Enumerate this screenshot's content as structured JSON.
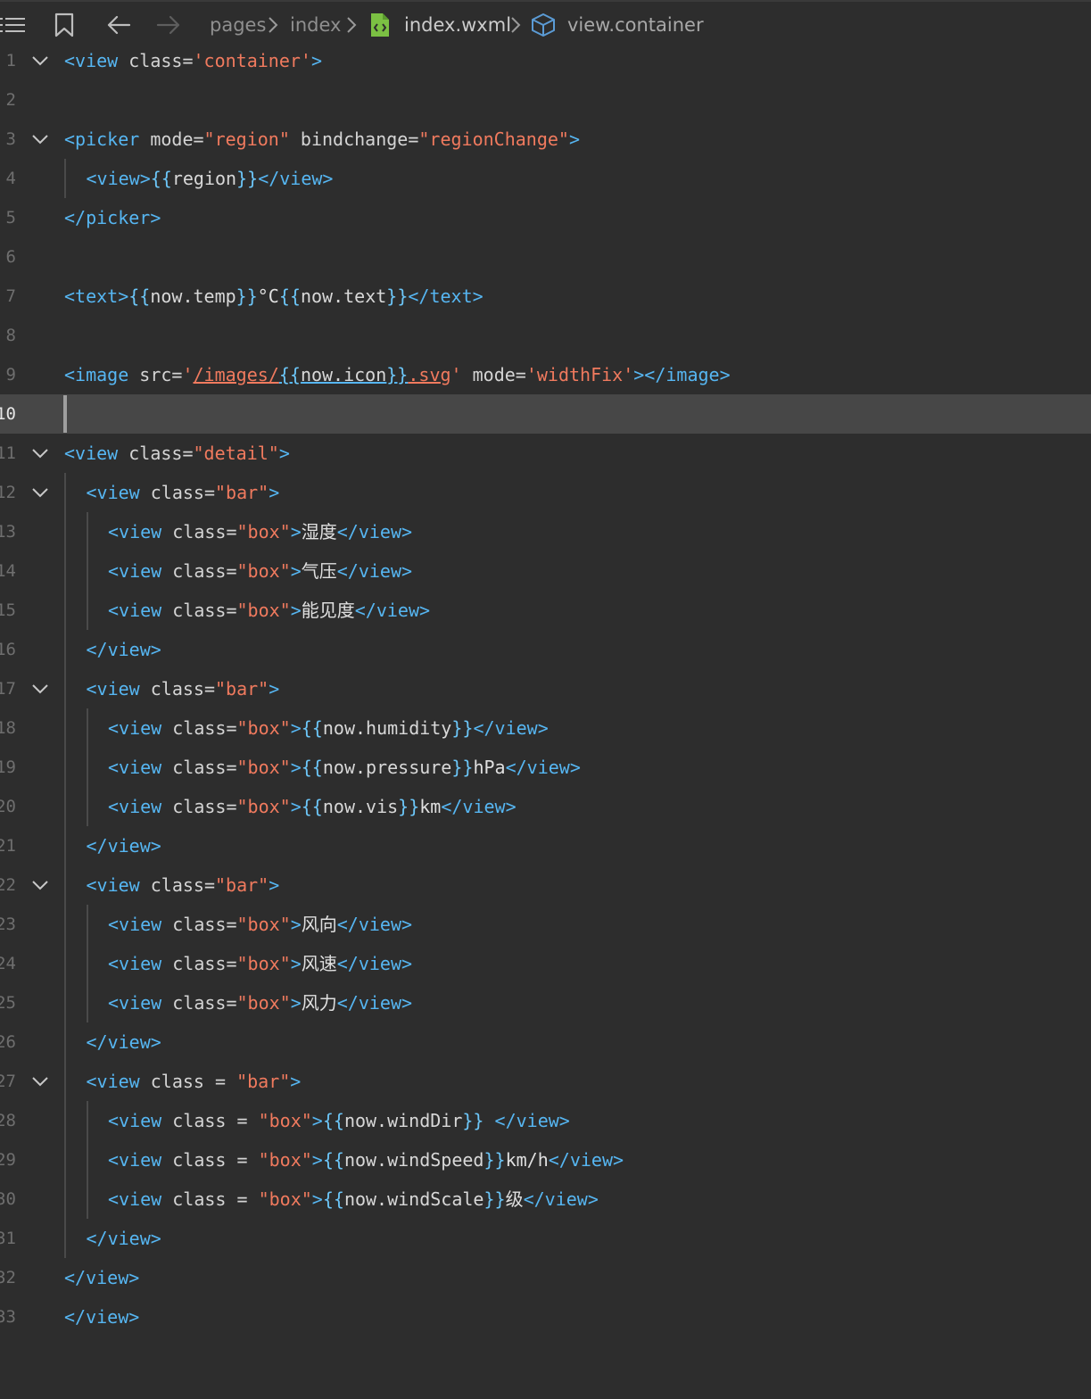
{
  "breadcrumb": {
    "items": [
      "pages",
      "index",
      "index.wxml",
      "view.container"
    ]
  },
  "lines": [
    {
      "n": "1",
      "fold": true,
      "indent": 0,
      "tokens": [
        [
          "tg",
          "<view "
        ],
        [
          "at",
          "class="
        ],
        [
          "st",
          "'container'"
        ],
        [
          "tg",
          ">"
        ]
      ]
    },
    {
      "n": "2",
      "fold": false,
      "indent": 0,
      "tokens": []
    },
    {
      "n": "3",
      "fold": true,
      "indent": 0,
      "tokens": [
        [
          "tg",
          "<picker "
        ],
        [
          "at",
          "mode="
        ],
        [
          "st",
          "\"region\""
        ],
        [
          "at",
          " bindchange="
        ],
        [
          "st",
          "\"regionChange\""
        ],
        [
          "tg",
          ">"
        ]
      ]
    },
    {
      "n": "4",
      "fold": false,
      "indent": 1,
      "tokens": [
        [
          "tg",
          "<view>"
        ],
        [
          "br",
          "{{"
        ],
        [
          "ex",
          "region"
        ],
        [
          "br",
          "}}"
        ],
        [
          "tg",
          "</view>"
        ]
      ]
    },
    {
      "n": "5",
      "fold": false,
      "indent": 0,
      "tokens": [
        [
          "tg",
          "</picker>"
        ]
      ]
    },
    {
      "n": "6",
      "fold": false,
      "indent": 0,
      "tokens": []
    },
    {
      "n": "7",
      "fold": false,
      "indent": 0,
      "tokens": [
        [
          "tg",
          "<text>"
        ],
        [
          "br",
          "{{"
        ],
        [
          "ex",
          "now.temp"
        ],
        [
          "br",
          "}}"
        ],
        [
          "tx",
          "°C"
        ],
        [
          "br",
          "{{"
        ],
        [
          "ex",
          "now.text"
        ],
        [
          "br",
          "}}"
        ],
        [
          "tg",
          "</text>"
        ]
      ]
    },
    {
      "n": "8",
      "fold": false,
      "indent": 0,
      "tokens": []
    },
    {
      "n": "9",
      "fold": false,
      "indent": 0,
      "tokens": [
        [
          "tg",
          "<image "
        ],
        [
          "at",
          "src="
        ],
        [
          "st",
          "'"
        ],
        [
          "stu",
          "/images/"
        ],
        [
          "bru",
          "{{"
        ],
        [
          "exu",
          "now.icon"
        ],
        [
          "bru",
          "}}"
        ],
        [
          "stu",
          ".svg"
        ],
        [
          "st",
          "'"
        ],
        [
          "at",
          " mode="
        ],
        [
          "st",
          "'widthFix'"
        ],
        [
          "tg",
          "></image>"
        ]
      ]
    },
    {
      "n": "10",
      "fold": false,
      "indent": 0,
      "current": true,
      "tokens": []
    },
    {
      "n": "11",
      "fold": true,
      "indent": 0,
      "tokens": [
        [
          "tg",
          "<view "
        ],
        [
          "at",
          "class="
        ],
        [
          "st",
          "\"detail\""
        ],
        [
          "tg",
          ">"
        ]
      ]
    },
    {
      "n": "12",
      "fold": true,
      "indent": 1,
      "tokens": [
        [
          "tg",
          "<view "
        ],
        [
          "at",
          "class="
        ],
        [
          "st",
          "\"bar\""
        ],
        [
          "tg",
          ">"
        ]
      ]
    },
    {
      "n": "13",
      "fold": false,
      "indent": 2,
      "tokens": [
        [
          "tg",
          "<view "
        ],
        [
          "at",
          "class="
        ],
        [
          "st",
          "\"box\""
        ],
        [
          "tg",
          ">"
        ],
        [
          "tx",
          "湿度"
        ],
        [
          "tg",
          "</view>"
        ]
      ]
    },
    {
      "n": "14",
      "fold": false,
      "indent": 2,
      "tokens": [
        [
          "tg",
          "<view "
        ],
        [
          "at",
          "class="
        ],
        [
          "st",
          "\"box\""
        ],
        [
          "tg",
          ">"
        ],
        [
          "tx",
          "气压"
        ],
        [
          "tg",
          "</view>"
        ]
      ]
    },
    {
      "n": "15",
      "fold": false,
      "indent": 2,
      "tokens": [
        [
          "tg",
          "<view "
        ],
        [
          "at",
          "class="
        ],
        [
          "st",
          "\"box\""
        ],
        [
          "tg",
          ">"
        ],
        [
          "tx",
          "能见度"
        ],
        [
          "tg",
          "</view>"
        ]
      ]
    },
    {
      "n": "16",
      "fold": false,
      "indent": 1,
      "tokens": [
        [
          "tg",
          "</view>"
        ]
      ]
    },
    {
      "n": "17",
      "fold": true,
      "indent": 1,
      "tokens": [
        [
          "tg",
          "<view "
        ],
        [
          "at",
          "class="
        ],
        [
          "st",
          "\"bar\""
        ],
        [
          "tg",
          ">"
        ]
      ]
    },
    {
      "n": "18",
      "fold": false,
      "indent": 2,
      "tokens": [
        [
          "tg",
          "<view "
        ],
        [
          "at",
          "class="
        ],
        [
          "st",
          "\"box\""
        ],
        [
          "tg",
          ">"
        ],
        [
          "br",
          "{{"
        ],
        [
          "ex",
          "now.humidity"
        ],
        [
          "br",
          "}}"
        ],
        [
          "tg",
          "</view>"
        ]
      ]
    },
    {
      "n": "19",
      "fold": false,
      "indent": 2,
      "tokens": [
        [
          "tg",
          "<view "
        ],
        [
          "at",
          "class="
        ],
        [
          "st",
          "\"box\""
        ],
        [
          "tg",
          ">"
        ],
        [
          "br",
          "{{"
        ],
        [
          "ex",
          "now.pressure"
        ],
        [
          "br",
          "}}"
        ],
        [
          "tx",
          "hPa"
        ],
        [
          "tg",
          "</view>"
        ]
      ]
    },
    {
      "n": "20",
      "fold": false,
      "indent": 2,
      "tokens": [
        [
          "tg",
          "<view "
        ],
        [
          "at",
          "class="
        ],
        [
          "st",
          "\"box\""
        ],
        [
          "tg",
          ">"
        ],
        [
          "br",
          "{{"
        ],
        [
          "ex",
          "now.vis"
        ],
        [
          "br",
          "}}"
        ],
        [
          "tx",
          "km"
        ],
        [
          "tg",
          "</view>"
        ]
      ]
    },
    {
      "n": "21",
      "fold": false,
      "indent": 1,
      "tokens": [
        [
          "tg",
          "</view>"
        ]
      ]
    },
    {
      "n": "22",
      "fold": true,
      "indent": 1,
      "tokens": [
        [
          "tg",
          "<view "
        ],
        [
          "at",
          "class="
        ],
        [
          "st",
          "\"bar\""
        ],
        [
          "tg",
          ">"
        ]
      ]
    },
    {
      "n": "23",
      "fold": false,
      "indent": 2,
      "tokens": [
        [
          "tg",
          "<view "
        ],
        [
          "at",
          "class="
        ],
        [
          "st",
          "\"box\""
        ],
        [
          "tg",
          ">"
        ],
        [
          "tx",
          "风向"
        ],
        [
          "tg",
          "</view>"
        ]
      ]
    },
    {
      "n": "24",
      "fold": false,
      "indent": 2,
      "tokens": [
        [
          "tg",
          "<view "
        ],
        [
          "at",
          "class="
        ],
        [
          "st",
          "\"box\""
        ],
        [
          "tg",
          ">"
        ],
        [
          "tx",
          "风速"
        ],
        [
          "tg",
          "</view>"
        ]
      ]
    },
    {
      "n": "25",
      "fold": false,
      "indent": 2,
      "tokens": [
        [
          "tg",
          "<view "
        ],
        [
          "at",
          "class="
        ],
        [
          "st",
          "\"box\""
        ],
        [
          "tg",
          ">"
        ],
        [
          "tx",
          "风力"
        ],
        [
          "tg",
          "</view>"
        ]
      ]
    },
    {
      "n": "26",
      "fold": false,
      "indent": 1,
      "tokens": [
        [
          "tg",
          "</view>"
        ]
      ]
    },
    {
      "n": "27",
      "fold": true,
      "indent": 1,
      "tokens": [
        [
          "tg",
          "<view "
        ],
        [
          "at",
          "class = "
        ],
        [
          "st",
          "\"bar\""
        ],
        [
          "tg",
          ">"
        ]
      ]
    },
    {
      "n": "28",
      "fold": false,
      "indent": 2,
      "tokens": [
        [
          "tg",
          "<view "
        ],
        [
          "at",
          "class = "
        ],
        [
          "st",
          "\"box\""
        ],
        [
          "tg",
          ">"
        ],
        [
          "br",
          "{{"
        ],
        [
          "ex",
          "now.windDir"
        ],
        [
          "br",
          "}}"
        ],
        [
          "tx",
          " "
        ],
        [
          "tg",
          "</view>"
        ]
      ]
    },
    {
      "n": "29",
      "fold": false,
      "indent": 2,
      "tokens": [
        [
          "tg",
          "<view "
        ],
        [
          "at",
          "class = "
        ],
        [
          "st",
          "\"box\""
        ],
        [
          "tg",
          ">"
        ],
        [
          "br",
          "{{"
        ],
        [
          "ex",
          "now.windSpeed"
        ],
        [
          "br",
          "}}"
        ],
        [
          "tx",
          "km/h"
        ],
        [
          "tg",
          "</view>"
        ]
      ]
    },
    {
      "n": "30",
      "fold": false,
      "indent": 2,
      "tokens": [
        [
          "tg",
          "<view "
        ],
        [
          "at",
          "class = "
        ],
        [
          "st",
          "\"box\""
        ],
        [
          "tg",
          ">"
        ],
        [
          "br",
          "{{"
        ],
        [
          "ex",
          "now.windScale"
        ],
        [
          "br",
          "}}"
        ],
        [
          "tx",
          "级"
        ],
        [
          "tg",
          "</view>"
        ]
      ]
    },
    {
      "n": "31",
      "fold": false,
      "indent": 1,
      "tokens": [
        [
          "tg",
          "</view>"
        ]
      ]
    },
    {
      "n": "32",
      "fold": false,
      "indent": 0,
      "tokens": [
        [
          "tg",
          "</view>"
        ]
      ]
    },
    {
      "n": "33",
      "fold": false,
      "indent": 0,
      "tokens": [
        [
          "tg",
          "</view>"
        ]
      ]
    }
  ]
}
